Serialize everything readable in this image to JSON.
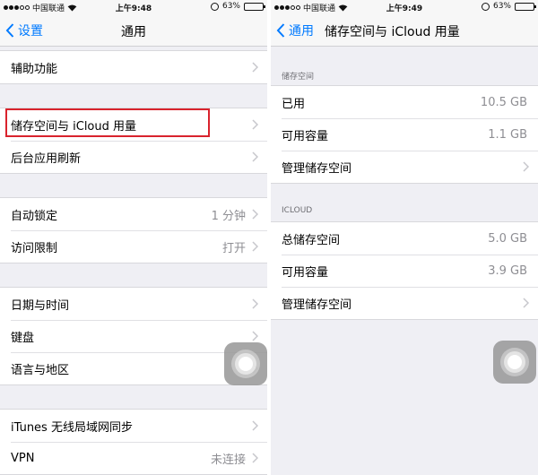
{
  "left": {
    "status": {
      "carrier": "中国联通",
      "time": "上午9:48",
      "battery": "63%"
    },
    "nav": {
      "back_label": "设置",
      "title": "通用"
    },
    "groups": [
      {
        "rows": [
          {
            "label": "辅助功能"
          }
        ]
      },
      {
        "rows": [
          {
            "label": "储存空间与 iCloud 用量"
          },
          {
            "label": "后台应用刷新"
          }
        ]
      },
      {
        "rows": [
          {
            "label": "自动锁定",
            "value": "1 分钟"
          },
          {
            "label": "访问限制",
            "value": "打开"
          }
        ]
      },
      {
        "rows": [
          {
            "label": "日期与时间"
          },
          {
            "label": "键盘"
          },
          {
            "label": "语言与地区"
          }
        ]
      },
      {
        "rows": [
          {
            "label": "iTunes 无线局域网同步"
          },
          {
            "label": "VPN",
            "value": "未连接"
          }
        ]
      }
    ]
  },
  "right": {
    "status": {
      "carrier": "中国联通",
      "time": "上午9:49",
      "battery": "63%"
    },
    "nav": {
      "back_label": "通用",
      "title": "储存空间与 iCloud 用量"
    },
    "storage": {
      "header": "储存空间",
      "rows": [
        {
          "label": "已用",
          "value": "10.5 GB"
        },
        {
          "label": "可用容量",
          "value": "1.1 GB"
        },
        {
          "label": "管理储存空间"
        }
      ]
    },
    "icloud": {
      "header": "ICLOUD",
      "rows": [
        {
          "label": "总储存空间",
          "value": "5.0 GB"
        },
        {
          "label": "可用容量",
          "value": "3.9 GB"
        },
        {
          "label": "管理储存空间"
        }
      ]
    }
  },
  "colors": {
    "accent": "#007aff",
    "highlight": "#d9232d",
    "background": "#efeff4"
  },
  "battery_level": 0.63
}
